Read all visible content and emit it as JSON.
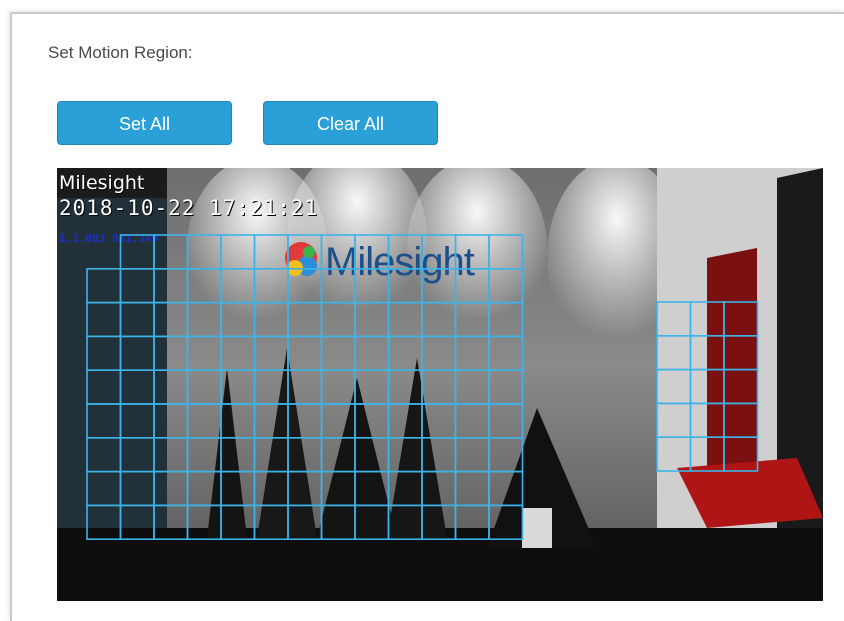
{
  "section": {
    "title": "Set Motion Region:"
  },
  "buttons": {
    "set_all": "Set All",
    "clear_all": "Clear All"
  },
  "video": {
    "osd_name": "Milesight",
    "osd_datetime": "2018-10-22 17:21:21",
    "osd_stats": "1.1.003  0x1.349",
    "wall_logo_text": "Milesight"
  },
  "colors": {
    "button": "#2b9fd8",
    "grid": "#3cb4e8"
  }
}
